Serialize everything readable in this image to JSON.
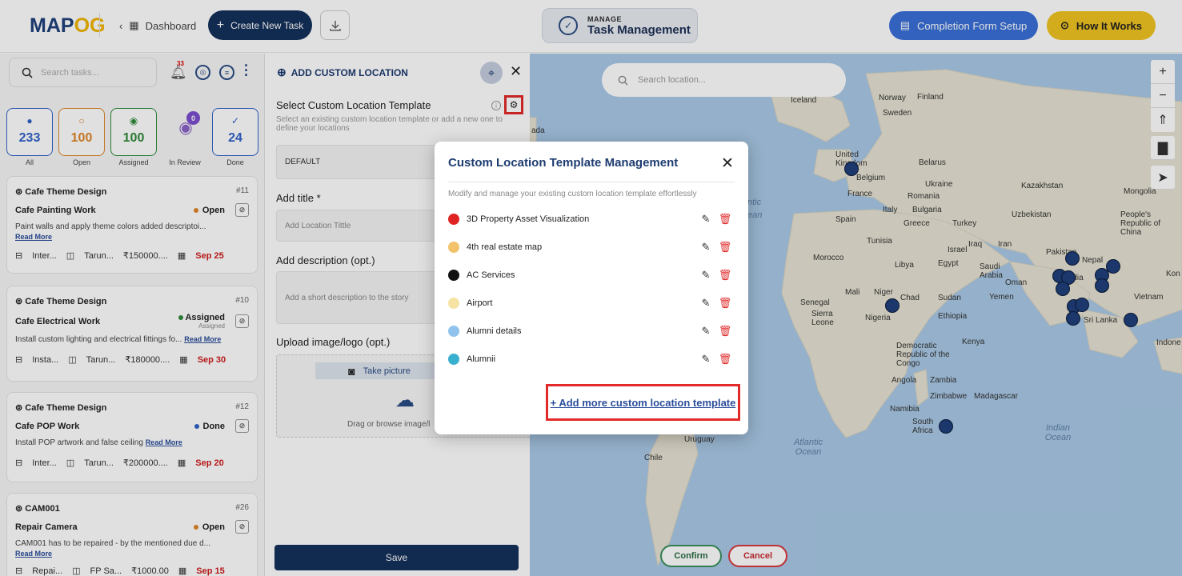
{
  "header": {
    "logo_a": "MAP",
    "logo_b": "OG",
    "dashboard_label": "Dashboard",
    "create_label": "Create New Task",
    "manage_small": "MANAGE",
    "manage_big": "Task Management",
    "completion_label": "Completion Form Setup",
    "how_label": "How It Works"
  },
  "sidebar": {
    "search_placeholder": "Search tasks...",
    "notif_count": "33",
    "stats": [
      {
        "value": "233",
        "label": "All",
        "color": "#2f62c8"
      },
      {
        "value": "100",
        "label": "Open",
        "color": "#e0862a"
      },
      {
        "value": "100",
        "label": "Assigned",
        "color": "#2f8a3a"
      },
      {
        "value": "24",
        "label": "Done",
        "color": "#2f62c8"
      }
    ],
    "review": {
      "count": "0",
      "label": "In Review"
    },
    "cards": [
      {
        "project": "Cafe Theme Design",
        "num": "#11",
        "title": "Cafe Painting Work",
        "status": "Open",
        "status_color": "#e0862a",
        "desc": "Paint walls and apply theme colors added descriptoi...",
        "read_more": "Read More",
        "m1": "Inter...",
        "m2": "Tarun...",
        "m3": "₹150000....",
        "due": "Sep 25"
      },
      {
        "project": "Cafe Theme Design",
        "num": "#10",
        "title": "Cafe Electrical Work",
        "status": "Assigned",
        "status_sub": "Assigned",
        "status_color": "#2f8a3a",
        "desc": "Install custom lighting and electrical fittings fo...",
        "read_more": "Read More",
        "m1": "Insta...",
        "m2": "Tarun...",
        "m3": "₹180000....",
        "due": "Sep 30"
      },
      {
        "project": "Cafe Theme Design",
        "num": "#12",
        "title": "Cafe POP Work",
        "status": "Done",
        "status_color": "#2f62c8",
        "desc": "Install POP artwork and false ceiling",
        "read_more": "Read More",
        "m1": "Inter...",
        "m2": "Tarun...",
        "m3": "₹200000....",
        "due": "Sep 20"
      },
      {
        "project": "CAM001",
        "num": "#26",
        "title": "Repair Camera",
        "status": "Open",
        "status_color": "#e0862a",
        "desc": "CAM001 has to be repaired - by the mentioned due d...",
        "read_more": "Read More",
        "m1": "Repai...",
        "m2": "FP Sa...",
        "m3": "₹1000.00",
        "due": "Sep 15"
      }
    ]
  },
  "form": {
    "heading": "ADD CUSTOM LOCATION",
    "select_label": "Select Custom Location Template",
    "select_sub": "Select an existing custom location template or add a new one to define your locations",
    "select_value": "DEFAULT",
    "title_label": "Add title *",
    "title_placeholder": "Add Location Tittle",
    "desc_label": "Add description (opt.)",
    "desc_placeholder": "Add a short description to the story",
    "upload_label": "Upload image/logo (opt.)",
    "take_picture": "Take picture",
    "drag_text": "Drag or browse image/l",
    "save_label": "Save"
  },
  "map": {
    "search_placeholder": "Search location...",
    "confirm_label": "Confirm",
    "cancel_label": "Cancel",
    "places": [
      "Iceland",
      "Norway",
      "Finland",
      "Sweden",
      "United Kingdom",
      "Belgium",
      "France",
      "Spain",
      "Belarus",
      "Ukraine",
      "Romania",
      "Italy",
      "Bulgaria",
      "Greece",
      "Turkey",
      "Kazakhstan",
      "Mongolia",
      "Uzbekistan",
      "People's Republic of China",
      "Tunisia",
      "Morocco",
      "Libya",
      "Egypt",
      "Iraq",
      "Iran",
      "Israel",
      "Saudi Arabia",
      "Oman",
      "Pakistan",
      "Nepal",
      "Mali",
      "Niger",
      "Chad",
      "Sudan",
      "Yemen",
      "Senegal",
      "Sierra Leone",
      "Nigeria",
      "Ethiopia",
      "Kenya",
      "Democratic Republic of the Congo",
      "Angola",
      "Zambia",
      "Zimbabwe",
      "Madagascar",
      "Namibia",
      "South Africa",
      "Uruguay",
      "Chile",
      "Vietnam",
      "Sri Lanka",
      "India",
      "Indone",
      "Kon",
      "ada"
    ],
    "oceans": [
      "Atlantic Ocean",
      "Indian Ocean",
      "ntic",
      "ean"
    ]
  },
  "modal": {
    "title": "Custom Location Template Management",
    "subtitle": "Modify and manage your existing custom location template effortlessly",
    "templates": [
      {
        "name": "3D Property Asset Visualization",
        "color": "#e02424"
      },
      {
        "name": "4th real estate map",
        "color": "#f2c36b"
      },
      {
        "name": "AC Services",
        "color": "#111111"
      },
      {
        "name": "Airport",
        "color": "#f5e3a3"
      },
      {
        "name": "Alumni details",
        "color": "#8fc3ee"
      },
      {
        "name": "Alumnii",
        "color": "#3ab0d0"
      }
    ],
    "add_link": "+ Add more custom location template"
  }
}
